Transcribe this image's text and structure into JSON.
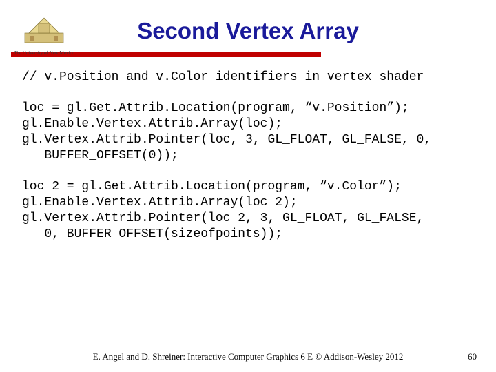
{
  "header": {
    "university": "The University of New Mexico",
    "title": "Second Vertex Array"
  },
  "code": {
    "comment": "// v.Position and v.Color identifiers in vertex shader",
    "block1_l1": "loc = gl.Get.Attrib.Location(program, “v.Position”);",
    "block1_l2": "gl.Enable.Vertex.Attrib.Array(loc);",
    "block1_l3": "gl.Vertex.Attrib.Pointer(loc, 3, GL_FLOAT, GL_FALSE, 0,",
    "block1_l4": "   BUFFER_OFFSET(0));",
    "block2_l1": "loc 2 = gl.Get.Attrib.Location(program, “v.Color”);",
    "block2_l2": "gl.Enable.Vertex.Attrib.Array(loc 2);",
    "block2_l3": "gl.Vertex.Attrib.Pointer(loc 2, 3, GL_FLOAT, GL_FALSE,",
    "block2_l4": "   0, BUFFER_OFFSET(sizeofpoints));"
  },
  "footer": {
    "credit": "E. Angel and D. Shreiner: Interactive Computer Graphics 6 E © Addison-Wesley 2012",
    "page": "60"
  }
}
